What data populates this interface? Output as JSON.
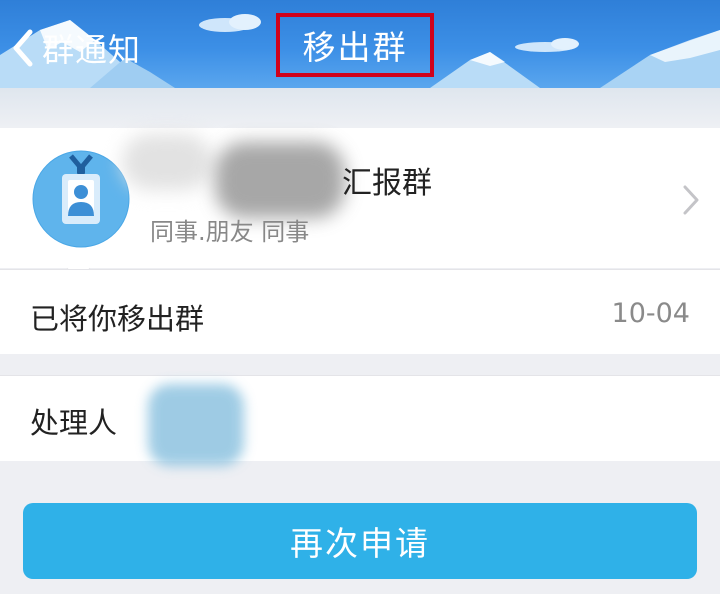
{
  "header": {
    "back_label": "群通知",
    "title": "移出群"
  },
  "group": {
    "name": "汇报群",
    "tags": "同事.朋友 同事",
    "avatar_icon": "id-badge-icon"
  },
  "notice": {
    "label": "已将你移出群",
    "date": "10-04"
  },
  "handler": {
    "label": "处理人"
  },
  "action": {
    "reapply_label": "再次申请"
  },
  "colors": {
    "header_blue": "#3c8fe6",
    "button_blue": "#2fb1e8",
    "highlight_red": "#d0021b"
  }
}
